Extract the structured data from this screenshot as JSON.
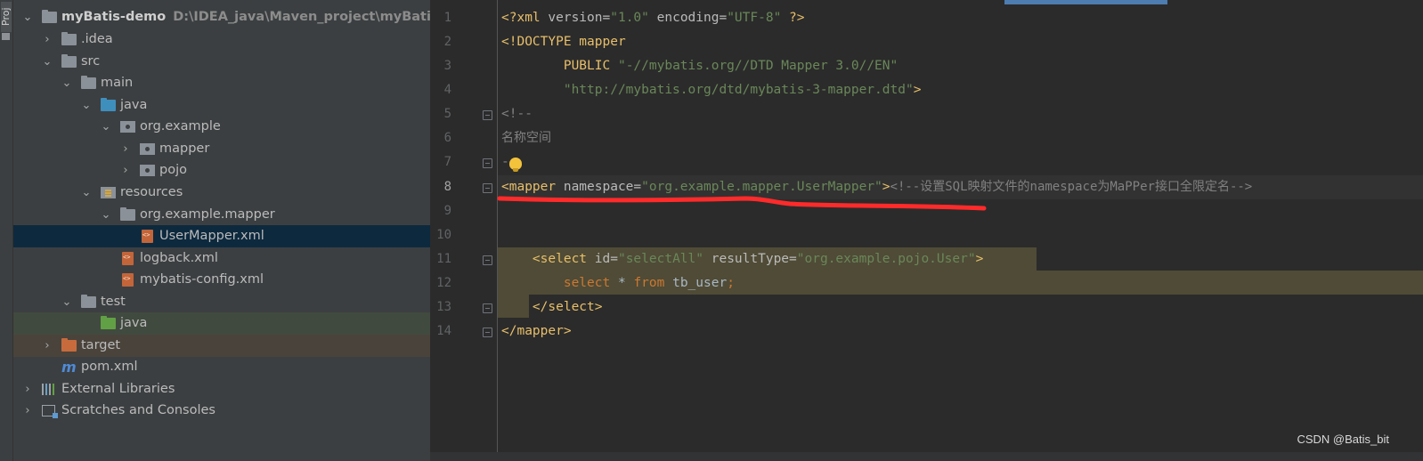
{
  "sidebar_strip": {
    "label": "Proj"
  },
  "project_tree": {
    "rows": [
      {
        "label": "myBatis-demo",
        "path": "D:\\IDEA_java\\Maven_project\\myBatis-der"
      },
      {
        "label": ".idea"
      },
      {
        "label": "src"
      },
      {
        "label": "main"
      },
      {
        "label": "java"
      },
      {
        "label": "org.example"
      },
      {
        "label": "mapper"
      },
      {
        "label": "pojo"
      },
      {
        "label": "resources"
      },
      {
        "label": "org.example.mapper"
      },
      {
        "label": "UserMapper.xml"
      },
      {
        "label": "logback.xml"
      },
      {
        "label": "mybatis-config.xml"
      },
      {
        "label": "test"
      },
      {
        "label": "java"
      },
      {
        "label": "target"
      },
      {
        "label": "pom.xml"
      },
      {
        "label": "External Libraries"
      },
      {
        "label": "Scratches and Consoles"
      }
    ]
  },
  "editor": {
    "line_numbers": [
      "1",
      "2",
      "3",
      "4",
      "5",
      "6",
      "7",
      "8",
      "9",
      "10",
      "11",
      "12",
      "13",
      "14"
    ],
    "lines": [
      [
        "<?xml ",
        "version",
        "=",
        "\"1.0\"",
        " ",
        "encoding",
        "=",
        "\"UTF-8\"",
        " ?>"
      ],
      [
        "<!DOCTYPE mapper"
      ],
      [
        "        ",
        "PUBLIC",
        " ",
        "\"-//mybatis.org//DTD Mapper 3.0//EN\""
      ],
      [
        "        ",
        "\"http://mybatis.org/dtd/mybatis-3-mapper.dtd\"",
        ">"
      ],
      [
        "<!--"
      ],
      [
        "名称空间"
      ],
      [
        "-"
      ],
      [
        "<mapper",
        " ",
        "namespace",
        "=",
        "\"org.example.mapper.UserMapper\"",
        ">",
        "<!--设置SQL映射文件的namespace为MaPPer接口全限定名-->"
      ],
      [
        ""
      ],
      [
        ""
      ],
      [
        "    ",
        "<select",
        " ",
        "id",
        "=",
        "\"selectAll\"",
        " ",
        "resultType",
        "=",
        "\"org.example.pojo.User\"",
        ">"
      ],
      [
        "        ",
        "select",
        " * ",
        "from",
        " tb_user",
        ";"
      ],
      [
        "    ",
        "</select>"
      ],
      [
        "</mapper>"
      ]
    ]
  },
  "watermark": "CSDN @Batis_bit",
  "colors": {
    "tag": "#e8bf6a",
    "string": "#6a8759",
    "keyword": "#cc7832",
    "comment": "#808080",
    "underline": "#ff2a2a"
  }
}
